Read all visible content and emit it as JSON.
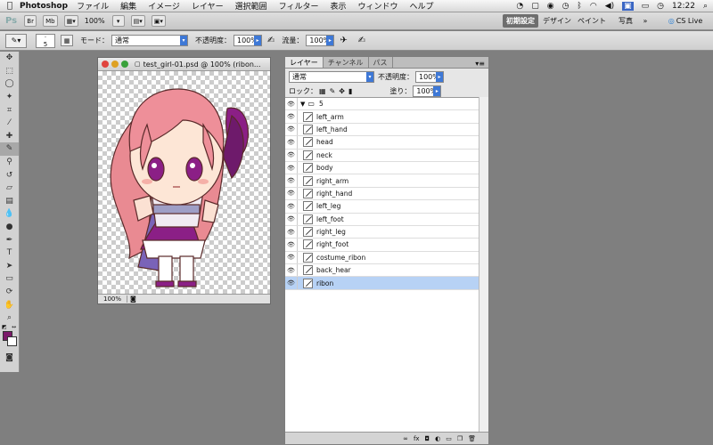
{
  "menubar": {
    "app": "Photoshop",
    "items": [
      "ファイル",
      "編集",
      "イメージ",
      "レイヤー",
      "選択範囲",
      "フィルター",
      "表示",
      "ウィンドウ",
      "ヘルプ"
    ],
    "time": "12:22"
  },
  "appbar": {
    "ps": "Ps",
    "zoom": "100%",
    "workspaces": [
      "初期設定",
      "デザイン",
      "ペイント",
      "写真"
    ],
    "more": "»",
    "cs_live": "CS Live"
  },
  "options": {
    "brush_size": "5",
    "mode_label": "モード：",
    "mode_value": "通常",
    "opacity_label": "不透明度：",
    "opacity_value": "100%",
    "flow_label": "流量：",
    "flow_value": "100%"
  },
  "document": {
    "title": "test_girl-01.psd @ 100% (ribon...",
    "zoom": "100%"
  },
  "layers_panel": {
    "tabs": [
      "レイヤー",
      "チャンネル",
      "パス"
    ],
    "blend_mode": "通常",
    "opacity_label": "不透明度：",
    "opacity_value": "100%",
    "lock_label": "ロック：",
    "fill_label": "塗り：",
    "fill_value": "100%",
    "group_name": "5",
    "layers": [
      "left_arm",
      "left_hand",
      "head",
      "neck",
      "body",
      "right_arm",
      "right_hand",
      "left_leg",
      "left_foot",
      "right_leg",
      "right_foot",
      "costume_ribon",
      "back_hear",
      "ribon"
    ]
  },
  "colors": {
    "foreground": "#7b1a6a",
    "background": "#ffffff",
    "selected_layer": "#b7d2f5"
  }
}
